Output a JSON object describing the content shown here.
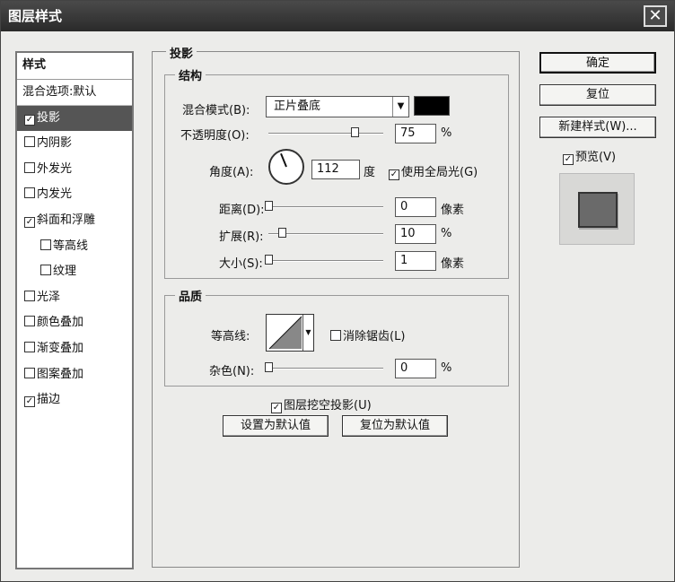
{
  "window": {
    "title": "图层样式",
    "close_glyph": "✕"
  },
  "left_panel": {
    "header": "样式",
    "items": [
      {
        "label": "混合选项:默认",
        "checkbox": false,
        "checked": false,
        "selected": false,
        "indent": false
      },
      {
        "label": "投影",
        "checkbox": true,
        "checked": true,
        "selected": true,
        "indent": false
      },
      {
        "label": "内阴影",
        "checkbox": true,
        "checked": false,
        "selected": false,
        "indent": false
      },
      {
        "label": "外发光",
        "checkbox": true,
        "checked": false,
        "selected": false,
        "indent": false
      },
      {
        "label": "内发光",
        "checkbox": true,
        "checked": false,
        "selected": false,
        "indent": false
      },
      {
        "label": "斜面和浮雕",
        "checkbox": true,
        "checked": true,
        "selected": false,
        "indent": false
      },
      {
        "label": "等高线",
        "checkbox": true,
        "checked": false,
        "selected": false,
        "indent": true
      },
      {
        "label": "纹理",
        "checkbox": true,
        "checked": false,
        "selected": false,
        "indent": true
      },
      {
        "label": "光泽",
        "checkbox": true,
        "checked": false,
        "selected": false,
        "indent": false
      },
      {
        "label": "颜色叠加",
        "checkbox": true,
        "checked": false,
        "selected": false,
        "indent": false
      },
      {
        "label": "渐变叠加",
        "checkbox": true,
        "checked": false,
        "selected": false,
        "indent": false
      },
      {
        "label": "图案叠加",
        "checkbox": true,
        "checked": false,
        "selected": false,
        "indent": false
      },
      {
        "label": "描边",
        "checkbox": true,
        "checked": true,
        "selected": false,
        "indent": false
      }
    ]
  },
  "drop_shadow": {
    "title": "投影",
    "structure": {
      "title": "结构",
      "blend_mode_label": "混合模式(B):",
      "blend_mode_value": "正片叠底",
      "shadow_color": "#000000",
      "opacity_label": "不透明度(O):",
      "opacity_value": "75",
      "opacity_level": 0.75,
      "opacity_unit": "%",
      "angle_label": "角度(A):",
      "angle_value": "112",
      "angle_degrees": 112,
      "angle_unit": "度",
      "global_light_label": "使用全局光(G)",
      "global_light_checked": true,
      "distance_label": "距离(D):",
      "distance_value": "0",
      "distance_unit": "像素",
      "spread_label": "扩展(R):",
      "spread_value": "10",
      "spread_unit": "%",
      "size_label": "大小(S):",
      "size_value": "1",
      "size_unit": "像素"
    },
    "quality": {
      "title": "品质",
      "contour_label": "等高线:",
      "anti_alias_label": "消除锯齿(L)",
      "anti_alias_checked": false,
      "noise_label": "杂色(N):",
      "noise_value": "0",
      "noise_unit": "%"
    },
    "knockout_label": "图层挖空投影(U)",
    "knockout_checked": true,
    "make_default_label": "设置为默认值",
    "reset_default_label": "复位为默认值"
  },
  "right": {
    "ok_label": "确定",
    "reset_label": "复位",
    "new_style_label": "新建样式(W)...",
    "preview_label": "预览(V)",
    "preview_checked": true
  }
}
